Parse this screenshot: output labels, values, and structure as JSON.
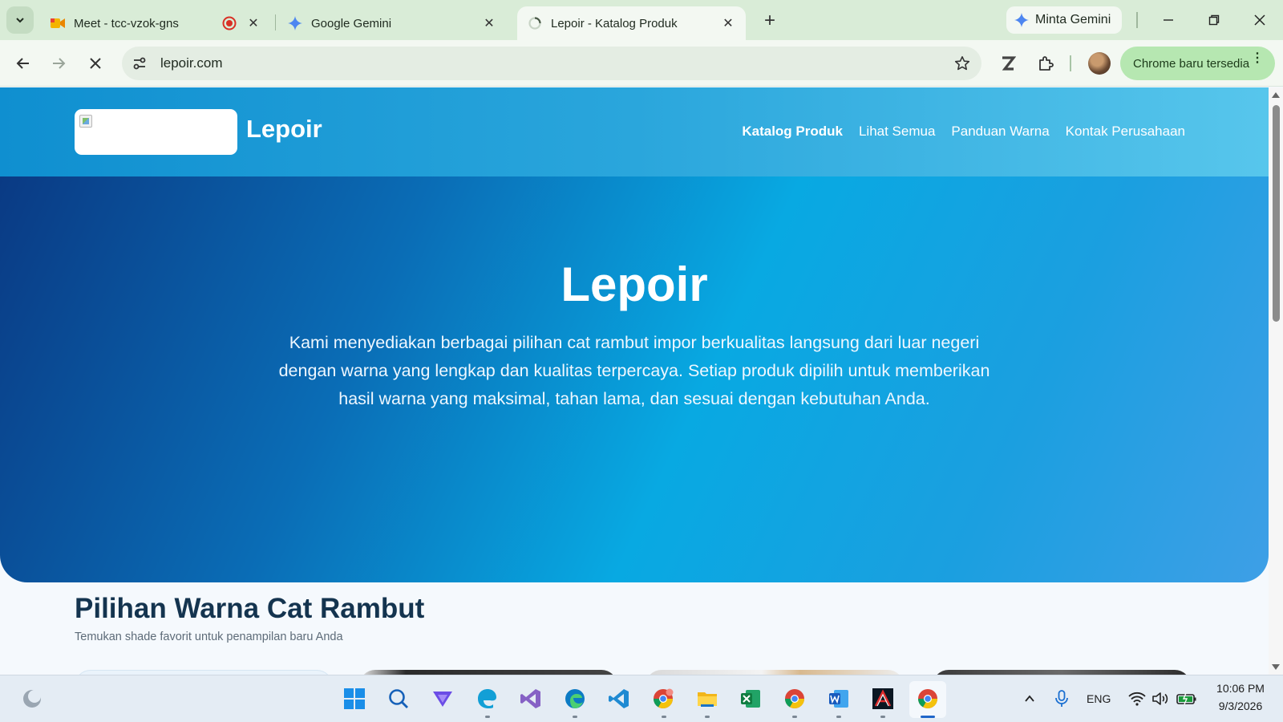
{
  "browser": {
    "tabs": [
      {
        "title": "Meet - tcc-vzok-gns",
        "icon": "google-meet-icon",
        "recording": true
      },
      {
        "title": "Google Gemini",
        "icon": "gemini-icon"
      },
      {
        "title": "Lepoir - Katalog Produk",
        "icon": "loading-spinner-icon",
        "active": true
      }
    ],
    "gemini_button": "Minta Gemini",
    "url": "lepoir.com",
    "update_button": "Chrome baru tersedia"
  },
  "site": {
    "name": "Lepoir",
    "nav": [
      {
        "label": "Katalog Produk",
        "active": true
      },
      {
        "label": "Lihat Semua"
      },
      {
        "label": "Panduan Warna"
      },
      {
        "label": "Kontak Perusahaan"
      }
    ],
    "hero": {
      "title": "Lepoir",
      "description": "Kami menyediakan berbagai pilihan cat rambut impor berkualitas langsung dari luar negeri dengan warna yang lengkap dan kualitas terpercaya. Setiap produk dipilih untuk memberikan hasil warna yang maksimal, tahan lama, dan sesuai dengan kebutuhan Anda."
    },
    "section": {
      "title": "Pilihan Warna Cat Rambut",
      "subtitle": "Temukan shade favorit untuk penampilan baru Anda"
    },
    "colors": {
      "header_start": "#0f8fd0",
      "header_end": "#57c6ec",
      "hero_dark": "#0a3a84",
      "hero_mid": "#08a9e2",
      "heading": "#14344f"
    }
  },
  "taskbar": {
    "apps": [
      "weather-icon",
      "windows-start-icon",
      "search-icon",
      "vpn-icon",
      "edge-dev-icon",
      "visual-studio-icon",
      "edge-icon",
      "vscode-icon",
      "chrome-profile-icon",
      "file-explorer-icon",
      "excel-icon",
      "chrome-icon",
      "word-icon",
      "autocad-icon",
      "chrome-active-icon"
    ],
    "language": "ENG",
    "time": "10:06 PM",
    "date": "9/3/2026"
  }
}
